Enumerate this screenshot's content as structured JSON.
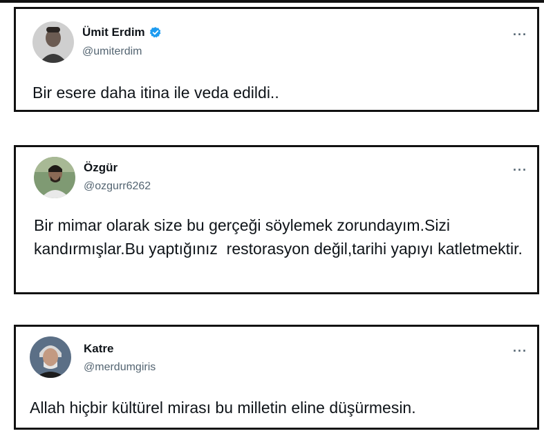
{
  "tweets": [
    {
      "name": "Ümit Erdim",
      "handle": "@umiterdim",
      "verified": true,
      "more_icon": "more-dots-icon",
      "text": "Bir esere daha itina ile veda edildi..",
      "avatar": "avatar-photo"
    },
    {
      "name": "Özgür",
      "handle": "@ozgurr6262",
      "verified": false,
      "more_icon": "more-dots-icon",
      "text": "Bir mimar olarak size bu gerçeği söylemek zorundayım.Sizi kandırmışlar.Bu yaptığınız  restorasyon değil,tarihi yapıyı katletmektir.",
      "avatar": "avatar-photo"
    },
    {
      "name": "Katre",
      "handle": "@merdumgiris",
      "verified": false,
      "more_icon": "more-dots-icon",
      "text": "Allah hiçbir kültürel mirası bu milletin eline düşürmesin.",
      "avatar": "avatar-photo"
    }
  ],
  "colors": {
    "text": "#0f1419",
    "muted": "#536471",
    "verified": "#1d9bf0",
    "border": "#111111"
  }
}
